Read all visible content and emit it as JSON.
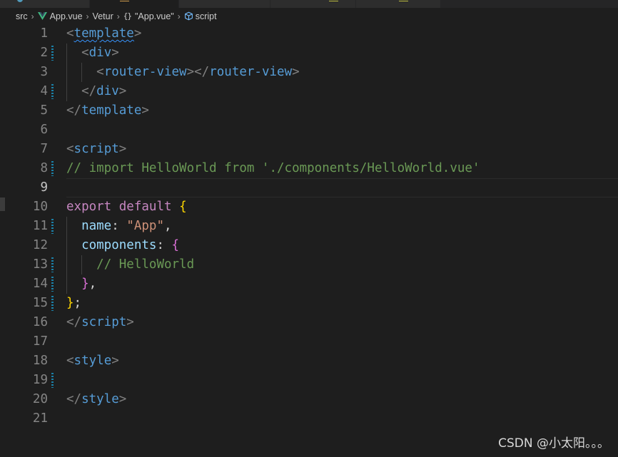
{
  "breadcrumb": {
    "items": [
      {
        "label": "src",
        "icon": "none"
      },
      {
        "label": "App.vue",
        "icon": "vue-icon"
      },
      {
        "label": "Vetur",
        "icon": "none"
      },
      {
        "label": "\"App.vue\"",
        "icon": "braces-icon"
      },
      {
        "label": "script",
        "icon": "cube-icon"
      }
    ],
    "braces_glyph": "{}"
  },
  "editor": {
    "current_line": 9,
    "lines": [
      {
        "n": "1",
        "tokens": [
          [
            "<",
            "punct"
          ],
          [
            "template",
            "tag-squiggle"
          ],
          [
            ">",
            "punct"
          ]
        ],
        "guides": 0,
        "mark": "none"
      },
      {
        "n": "2",
        "tokens": [
          [
            "  ",
            "text"
          ],
          [
            "<",
            "punct"
          ],
          [
            "div",
            "tag"
          ],
          [
            ">",
            "punct"
          ]
        ],
        "guides": 1,
        "mark": "dotted"
      },
      {
        "n": "3",
        "tokens": [
          [
            "    ",
            "text"
          ],
          [
            "<",
            "punct"
          ],
          [
            "router-view",
            "tag"
          ],
          [
            "></",
            "punct"
          ],
          [
            "router-view",
            "tag"
          ],
          [
            ">",
            "punct"
          ]
        ],
        "guides": 2,
        "mark": "none"
      },
      {
        "n": "4",
        "tokens": [
          [
            "  ",
            "text"
          ],
          [
            "</",
            "punct"
          ],
          [
            "div",
            "tag"
          ],
          [
            ">",
            "punct"
          ]
        ],
        "guides": 1,
        "mark": "dotted"
      },
      {
        "n": "5",
        "tokens": [
          [
            "</",
            "punct"
          ],
          [
            "template",
            "tag"
          ],
          [
            ">",
            "punct"
          ]
        ],
        "guides": 0,
        "mark": "none"
      },
      {
        "n": "6",
        "tokens": [],
        "guides": 0,
        "mark": "none"
      },
      {
        "n": "7",
        "tokens": [
          [
            "<",
            "punct"
          ],
          [
            "script",
            "tag"
          ],
          [
            ">",
            "punct"
          ]
        ],
        "guides": 0,
        "mark": "none"
      },
      {
        "n": "8",
        "tokens": [
          [
            "// import HelloWorld from './components/HelloWorld.vue'",
            "comment"
          ]
        ],
        "guides": 0,
        "mark": "dotted"
      },
      {
        "n": "9",
        "tokens": [],
        "guides": 0,
        "mark": "none"
      },
      {
        "n": "10",
        "tokens": [
          [
            "export",
            "keyword"
          ],
          [
            " ",
            "text"
          ],
          [
            "default",
            "keyword"
          ],
          [
            " ",
            "text"
          ],
          [
            "{",
            "brace1"
          ]
        ],
        "guides": 0,
        "mark": "none"
      },
      {
        "n": "11",
        "tokens": [
          [
            "  ",
            "text"
          ],
          [
            "name",
            "prop"
          ],
          [
            ": ",
            "text"
          ],
          [
            "\"App\"",
            "string"
          ],
          [
            ",",
            "text"
          ]
        ],
        "guides": 1,
        "mark": "dotted"
      },
      {
        "n": "12",
        "tokens": [
          [
            "  ",
            "text"
          ],
          [
            "components",
            "prop"
          ],
          [
            ": ",
            "text"
          ],
          [
            "{",
            "brace2"
          ]
        ],
        "guides": 1,
        "mark": "none"
      },
      {
        "n": "13",
        "tokens": [
          [
            "    ",
            "text"
          ],
          [
            "// HelloWorld",
            "comment"
          ]
        ],
        "guides": 2,
        "mark": "dotted"
      },
      {
        "n": "14",
        "tokens": [
          [
            "  ",
            "text"
          ],
          [
            "}",
            "brace2"
          ],
          [
            ",",
            "text"
          ]
        ],
        "guides": 1,
        "mark": "dotted"
      },
      {
        "n": "15",
        "tokens": [
          [
            "}",
            "brace1"
          ],
          [
            ";",
            "text"
          ]
        ],
        "guides": 0,
        "mark": "dotted"
      },
      {
        "n": "16",
        "tokens": [
          [
            "</",
            "punct"
          ],
          [
            "script",
            "tag"
          ],
          [
            ">",
            "punct"
          ]
        ],
        "guides": 0,
        "mark": "none"
      },
      {
        "n": "17",
        "tokens": [],
        "guides": 0,
        "mark": "none"
      },
      {
        "n": "18",
        "tokens": [
          [
            "<",
            "punct"
          ],
          [
            "style",
            "tag"
          ],
          [
            ">",
            "punct"
          ]
        ],
        "guides": 0,
        "mark": "none"
      },
      {
        "n": "19",
        "tokens": [],
        "guides": 0,
        "mark": "dotted"
      },
      {
        "n": "20",
        "tokens": [
          [
            "</",
            "punct"
          ],
          [
            "style",
            "tag"
          ],
          [
            ">",
            "punct"
          ]
        ],
        "guides": 0,
        "mark": "none"
      },
      {
        "n": "21",
        "tokens": [],
        "guides": 0,
        "mark": "none"
      }
    ]
  },
  "watermark": "CSDN @小太阳。。。",
  "colors": {
    "background": "#1e1e1e",
    "tag": "#569cd6",
    "comment": "#6a9955",
    "keyword": "#c586c0",
    "string": "#ce9178",
    "property": "#9cdcfe",
    "brace_level1": "#ffd700",
    "brace_level2": "#da70d6",
    "gutter_change": "#1b81a8"
  }
}
